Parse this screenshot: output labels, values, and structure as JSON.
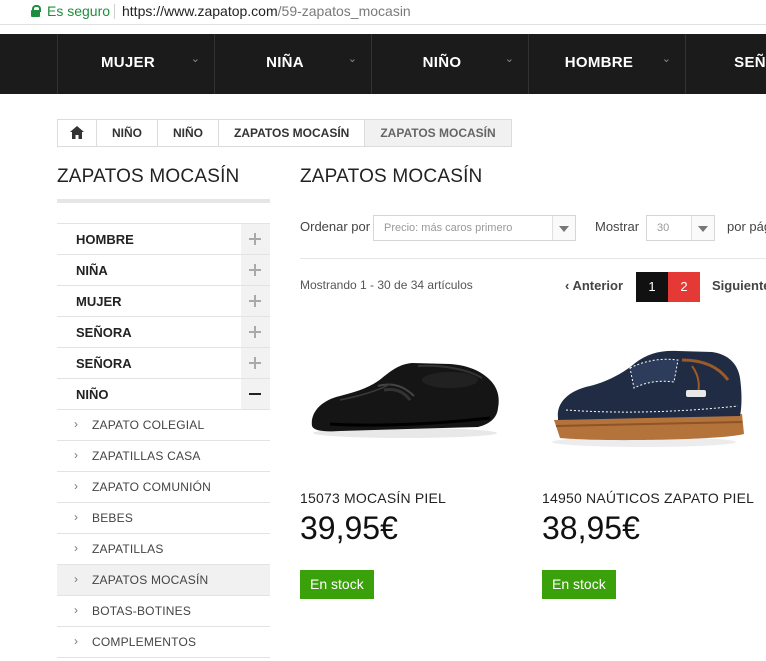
{
  "browser": {
    "secure_label": "Es seguro",
    "url_host": "https://www.zapatop.com",
    "url_path": "/59-zapatos_mocasin"
  },
  "topnav": {
    "items": [
      {
        "label": "MUJER"
      },
      {
        "label": "NIÑA"
      },
      {
        "label": "NIÑO"
      },
      {
        "label": "HOMBRE"
      },
      {
        "label": "SEÑO"
      }
    ]
  },
  "breadcrumb": {
    "items": [
      "NIÑO",
      "NIÑO",
      "ZAPATOS MOCASÍN",
      "ZAPATOS MOCASÍN"
    ]
  },
  "sidebar": {
    "title": "ZAPATOS MOCASÍN",
    "categories": [
      {
        "label": "HOMBRE",
        "toggle": "+"
      },
      {
        "label": "NIÑA",
        "toggle": "+"
      },
      {
        "label": "MUJER",
        "toggle": "+"
      },
      {
        "label": "SEÑORA",
        "toggle": "+"
      },
      {
        "label": "SEÑORA",
        "toggle": "+"
      },
      {
        "label": "NIÑO",
        "toggle": "−"
      }
    ],
    "subcategories": [
      {
        "label": "ZAPATO COLEGIAL"
      },
      {
        "label": "ZAPATILLAS CASA"
      },
      {
        "label": "ZAPATO COMUNIÓN"
      },
      {
        "label": "BEBES"
      },
      {
        "label": "ZAPATILLAS"
      },
      {
        "label": "ZAPATOS MOCASÍN",
        "active": true
      },
      {
        "label": "BOTAS-BOTINES"
      },
      {
        "label": "COMPLEMENTOS"
      }
    ]
  },
  "main": {
    "title": "ZAPATOS MOCASÍN",
    "sort_label": "Ordenar por",
    "sort_value": "Precio: más caros primero",
    "show_label": "Mostrar",
    "show_value": "30",
    "per_page_label": "por pág",
    "showing_text": "Mostrando 1 - 30 de 34 artículos",
    "prev_label": "Anterior",
    "pages": [
      "1",
      "2"
    ],
    "current_page": "1",
    "next_label": "Siguiente"
  },
  "products": [
    {
      "name": "15073 MOCASÍN PIEL",
      "price": "39,95€",
      "stock": "En stock"
    },
    {
      "name": "14950 NAÚTICOS ZAPATO PIEL",
      "price": "38,95€",
      "stock": "En stock"
    }
  ],
  "colors": {
    "nav_bg": "#1b1b1b",
    "accent_red": "#e53935",
    "stock_green": "#3aa10b",
    "secure_green": "#1e8e3e"
  }
}
